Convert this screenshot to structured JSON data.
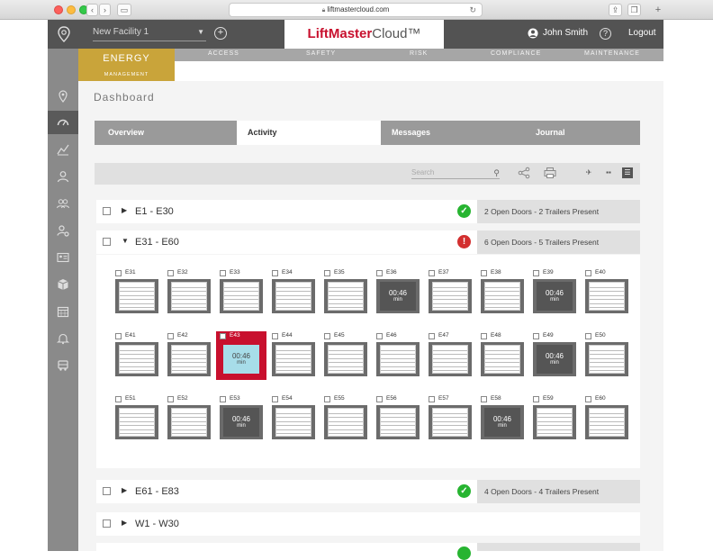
{
  "browser": {
    "url": "liftmastercloud.com"
  },
  "header": {
    "facility": "New Facility 1",
    "logo_main": "LiftMaster",
    "logo_cloud": "Cloud™",
    "user": "John Smith",
    "help": "?",
    "logout": "Logout"
  },
  "nav": {
    "energy": "ENERGY",
    "management": "MANAGEMENT",
    "items": [
      "ACCESS",
      "SAFETY",
      "RISK",
      "COMPLIANCE",
      "MAINTENANCE"
    ]
  },
  "page": {
    "title": "Dashboard",
    "tabs": [
      "Overview",
      "Activity",
      "Messages",
      "Journal"
    ],
    "active_tab": "Activity",
    "search_placeholder": "Search"
  },
  "groups": [
    {
      "label": "E1 - E30",
      "status": "ok",
      "summary": "2 Open Doors - 2 Trailers Present",
      "expanded": false
    },
    {
      "label": "E31 - E60",
      "status": "alert",
      "summary": "6 Open Doors - 5 Trailers Present",
      "expanded": true
    },
    {
      "label": "E61 - E83",
      "status": "ok",
      "summary": "4 Open Doors - 4 Trailers Present",
      "expanded": false
    },
    {
      "label": "W1 - W30",
      "status": "",
      "summary": "",
      "expanded": false
    }
  ],
  "doors": [
    [
      {
        "id": "E31"
      },
      {
        "id": "E32"
      },
      {
        "id": "E33"
      },
      {
        "id": "E34"
      },
      {
        "id": "E35"
      },
      {
        "id": "E36",
        "time": "00:46",
        "unit": "min"
      },
      {
        "id": "E37"
      },
      {
        "id": "E38"
      },
      {
        "id": "E39",
        "time": "00:46",
        "unit": "min"
      },
      {
        "id": "E40"
      }
    ],
    [
      {
        "id": "E41"
      },
      {
        "id": "E42"
      },
      {
        "id": "E43",
        "time": "00:46",
        "unit": "min",
        "alert": true
      },
      {
        "id": "E44"
      },
      {
        "id": "E45"
      },
      {
        "id": "E46"
      },
      {
        "id": "E47"
      },
      {
        "id": "E48"
      },
      {
        "id": "E49",
        "time": "00:46",
        "unit": "min"
      },
      {
        "id": "E50"
      }
    ],
    [
      {
        "id": "E51"
      },
      {
        "id": "E52"
      },
      {
        "id": "E53",
        "time": "00:46",
        "unit": "min"
      },
      {
        "id": "E54"
      },
      {
        "id": "E55"
      },
      {
        "id": "E56"
      },
      {
        "id": "E57"
      },
      {
        "id": "E58",
        "time": "00:46",
        "unit": "min"
      },
      {
        "id": "E59"
      },
      {
        "id": "E60"
      }
    ]
  ]
}
